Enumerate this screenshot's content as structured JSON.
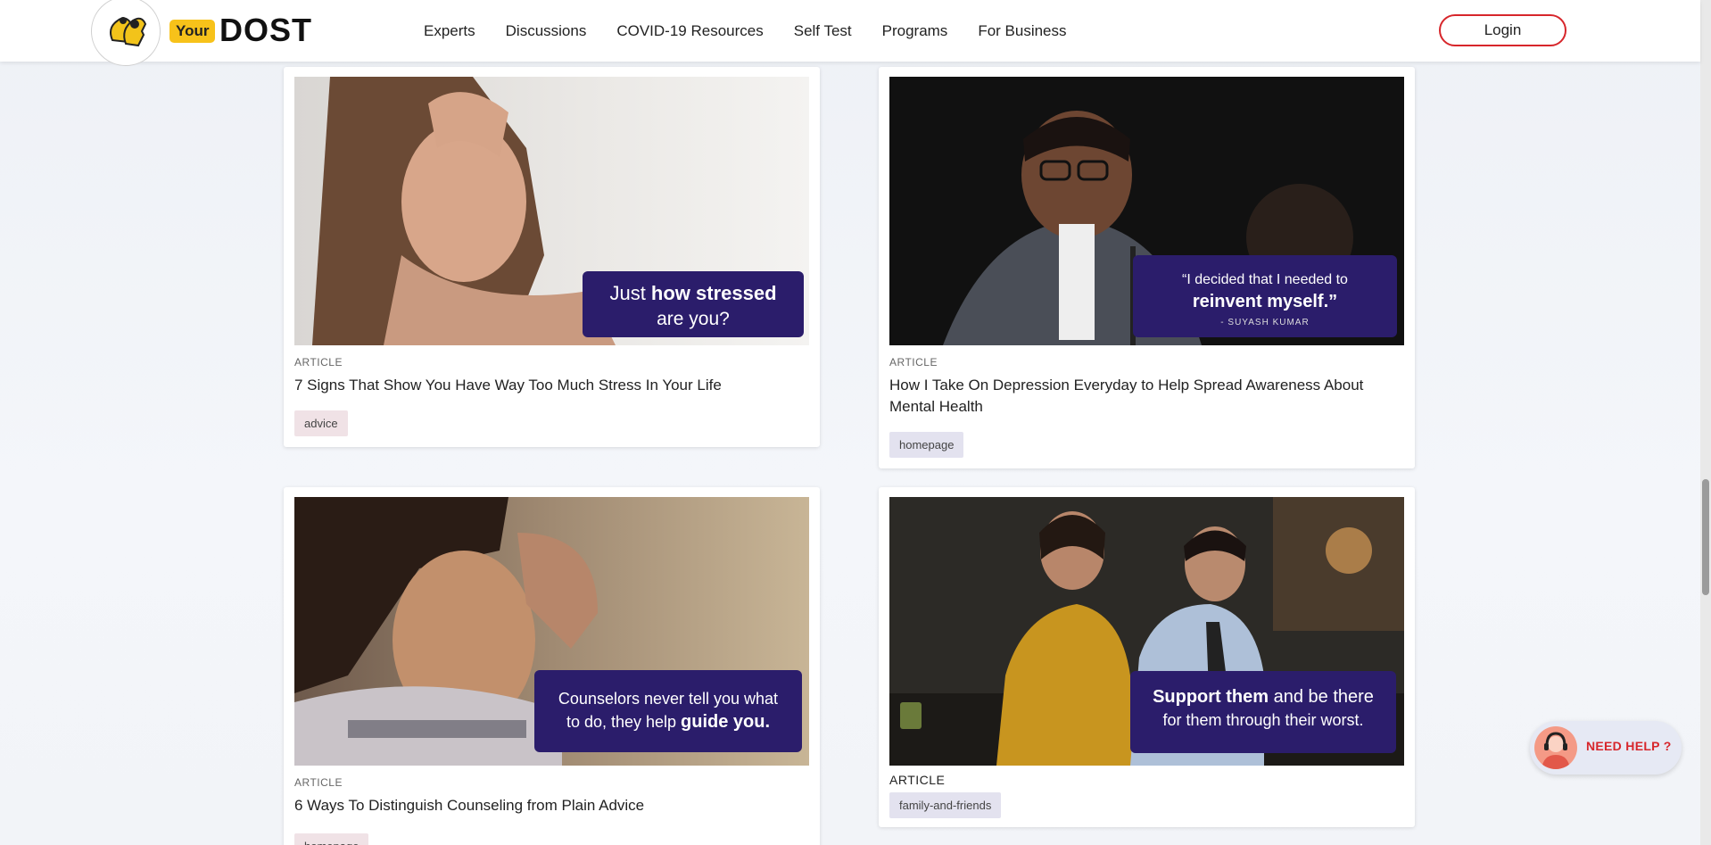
{
  "header": {
    "logo_your": "Your",
    "logo_dost": "DOST",
    "nav": [
      "Experts",
      "Discussions",
      "COVID-19 Resources",
      "Self Test",
      "Programs",
      "For Business"
    ],
    "login_label": "Login"
  },
  "cards": [
    {
      "type": "ARTICLE",
      "title": "7 Signs That Show You Have Way Too Much Stress In Your Life",
      "tag": "advice",
      "img_text_1": "Just ",
      "img_text_1b": "how stressed",
      "img_text_2": "are you?"
    },
    {
      "type": "ARTICLE",
      "title": "How I Take On Depression Everyday to Help Spread Awareness About Mental Health",
      "tag": "homepage",
      "img_text_1": "“I decided that I needed to",
      "img_text_2": "reinvent myself.”",
      "img_text_3": "- SUYASH KUMAR"
    },
    {
      "type": "ARTICLE",
      "title": "6 Ways To Distinguish Counseling from Plain Advice",
      "tag": "homepage",
      "img_text_1": "Counselors never tell you what",
      "img_text_2": "to do, they help ",
      "img_text_2b": "guide you."
    },
    {
      "type": "ARTICLE",
      "title": "",
      "tag": "family-and-friends",
      "img_text_1": "Support them",
      "img_text_1b": " and be there",
      "img_text_2": "for them through their worst."
    }
  ],
  "need_help": {
    "label": "NEED HELP ?"
  },
  "colors": {
    "brand_red": "#d7262b",
    "brand_yellow": "#f7c21a",
    "banner_purple": "#2b1d6b"
  }
}
